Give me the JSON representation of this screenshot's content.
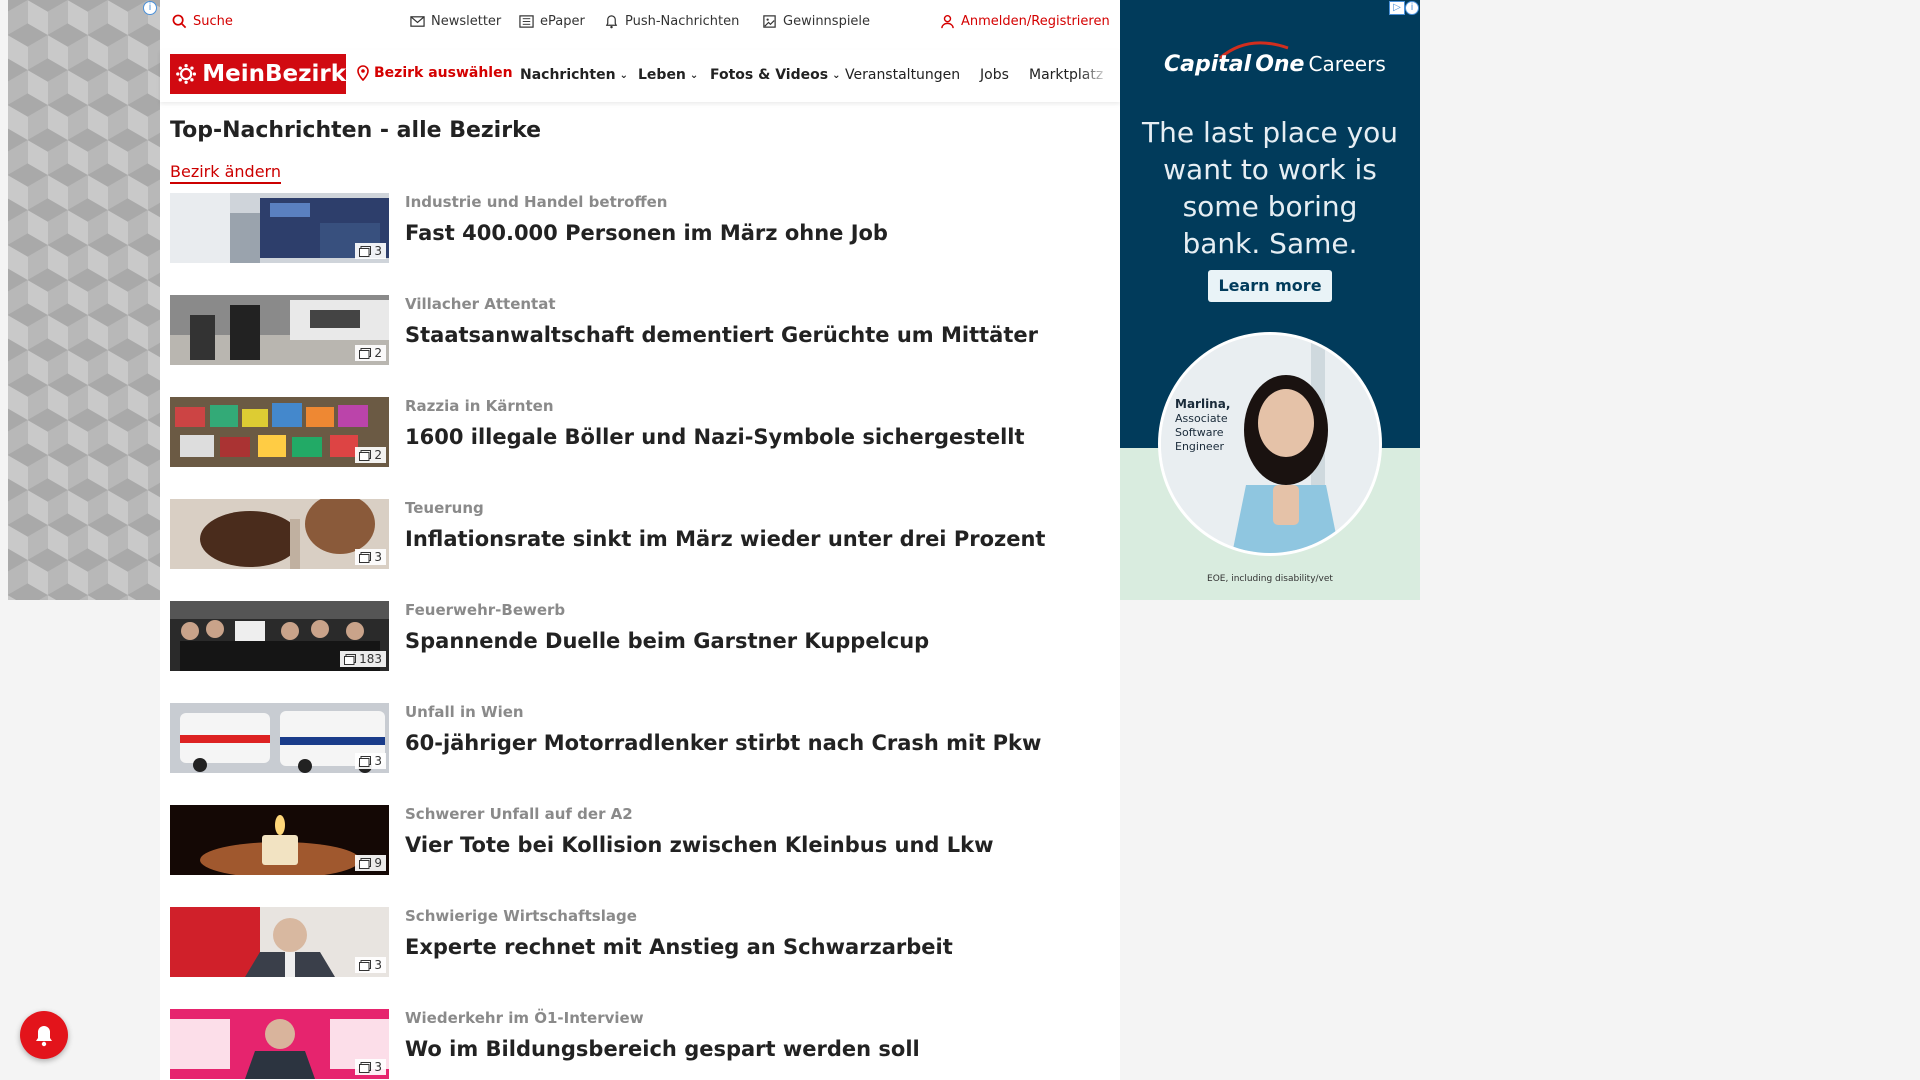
{
  "topbar": {
    "search": "Suche",
    "newsletter": "Newsletter",
    "epaper": "ePaper",
    "push": "Push-Nachrichten",
    "gewinnspiele": "Gewinnspiele",
    "login": "Anmelden/Registrieren"
  },
  "nav": {
    "logo": "MeinBezirk",
    "bezirk": "Bezirk auswählen",
    "items": [
      "Nachrichten",
      "Leben",
      "Fotos & Videos",
      "Veranstaltungen",
      "Jobs",
      "Marktplatz"
    ]
  },
  "page": {
    "title": "Top-Nachrichten - alle Bezirke",
    "change_link": "Bezirk ändern"
  },
  "articles": [
    {
      "kicker": "Industrie und Handel betroffen",
      "headline": "Fast 400.000 Personen im März ohne Job",
      "images": "3"
    },
    {
      "kicker": "Villacher Attentat",
      "headline": "Staatsanwaltschaft dementiert Gerüchte um Mittäter",
      "images": "2"
    },
    {
      "kicker": "Razzia in Kärnten",
      "headline": "1600 illegale Böller und Nazi-Symbole sichergestellt",
      "images": "2"
    },
    {
      "kicker": "Teuerung",
      "headline": "Inflationsrate sinkt im März wieder unter drei Prozent",
      "images": "3"
    },
    {
      "kicker": "Feuerwehr-Bewerb",
      "headline": "Spannende Duelle beim Garstner Kuppelcup",
      "images": "183"
    },
    {
      "kicker": "Unfall in Wien",
      "headline": "60-jähriger Motorradlenker stirbt nach Crash mit Pkw",
      "images": "3"
    },
    {
      "kicker": "Schwerer Unfall auf der A2",
      "headline": "Vier Tote bei Kollision zwischen Kleinbus und Lkw",
      "images": "9"
    },
    {
      "kicker": "Schwierige Wirtschaftslage",
      "headline": "Experte rechnet mit Anstieg an Schwarzarbeit",
      "images": "3"
    },
    {
      "kicker": "Wiederkehr im Ö1-Interview",
      "headline": "Wo im Bildungsbereich gespart werden soll",
      "images": "3"
    }
  ],
  "ad": {
    "brand": "Capital",
    "brand2": "One",
    "careers": "Careers",
    "headline": "The last place you want to work is some boring bank. Same.",
    "cta": "Learn more",
    "person_name": "Marlina,",
    "person_role1": "Associate",
    "person_role2": "Software",
    "person_role3": "Engineer",
    "eoe": "EOE, including disability/vet"
  },
  "colors": {
    "brand_red": "#d10a11",
    "ad_navy": "#013b5b"
  }
}
